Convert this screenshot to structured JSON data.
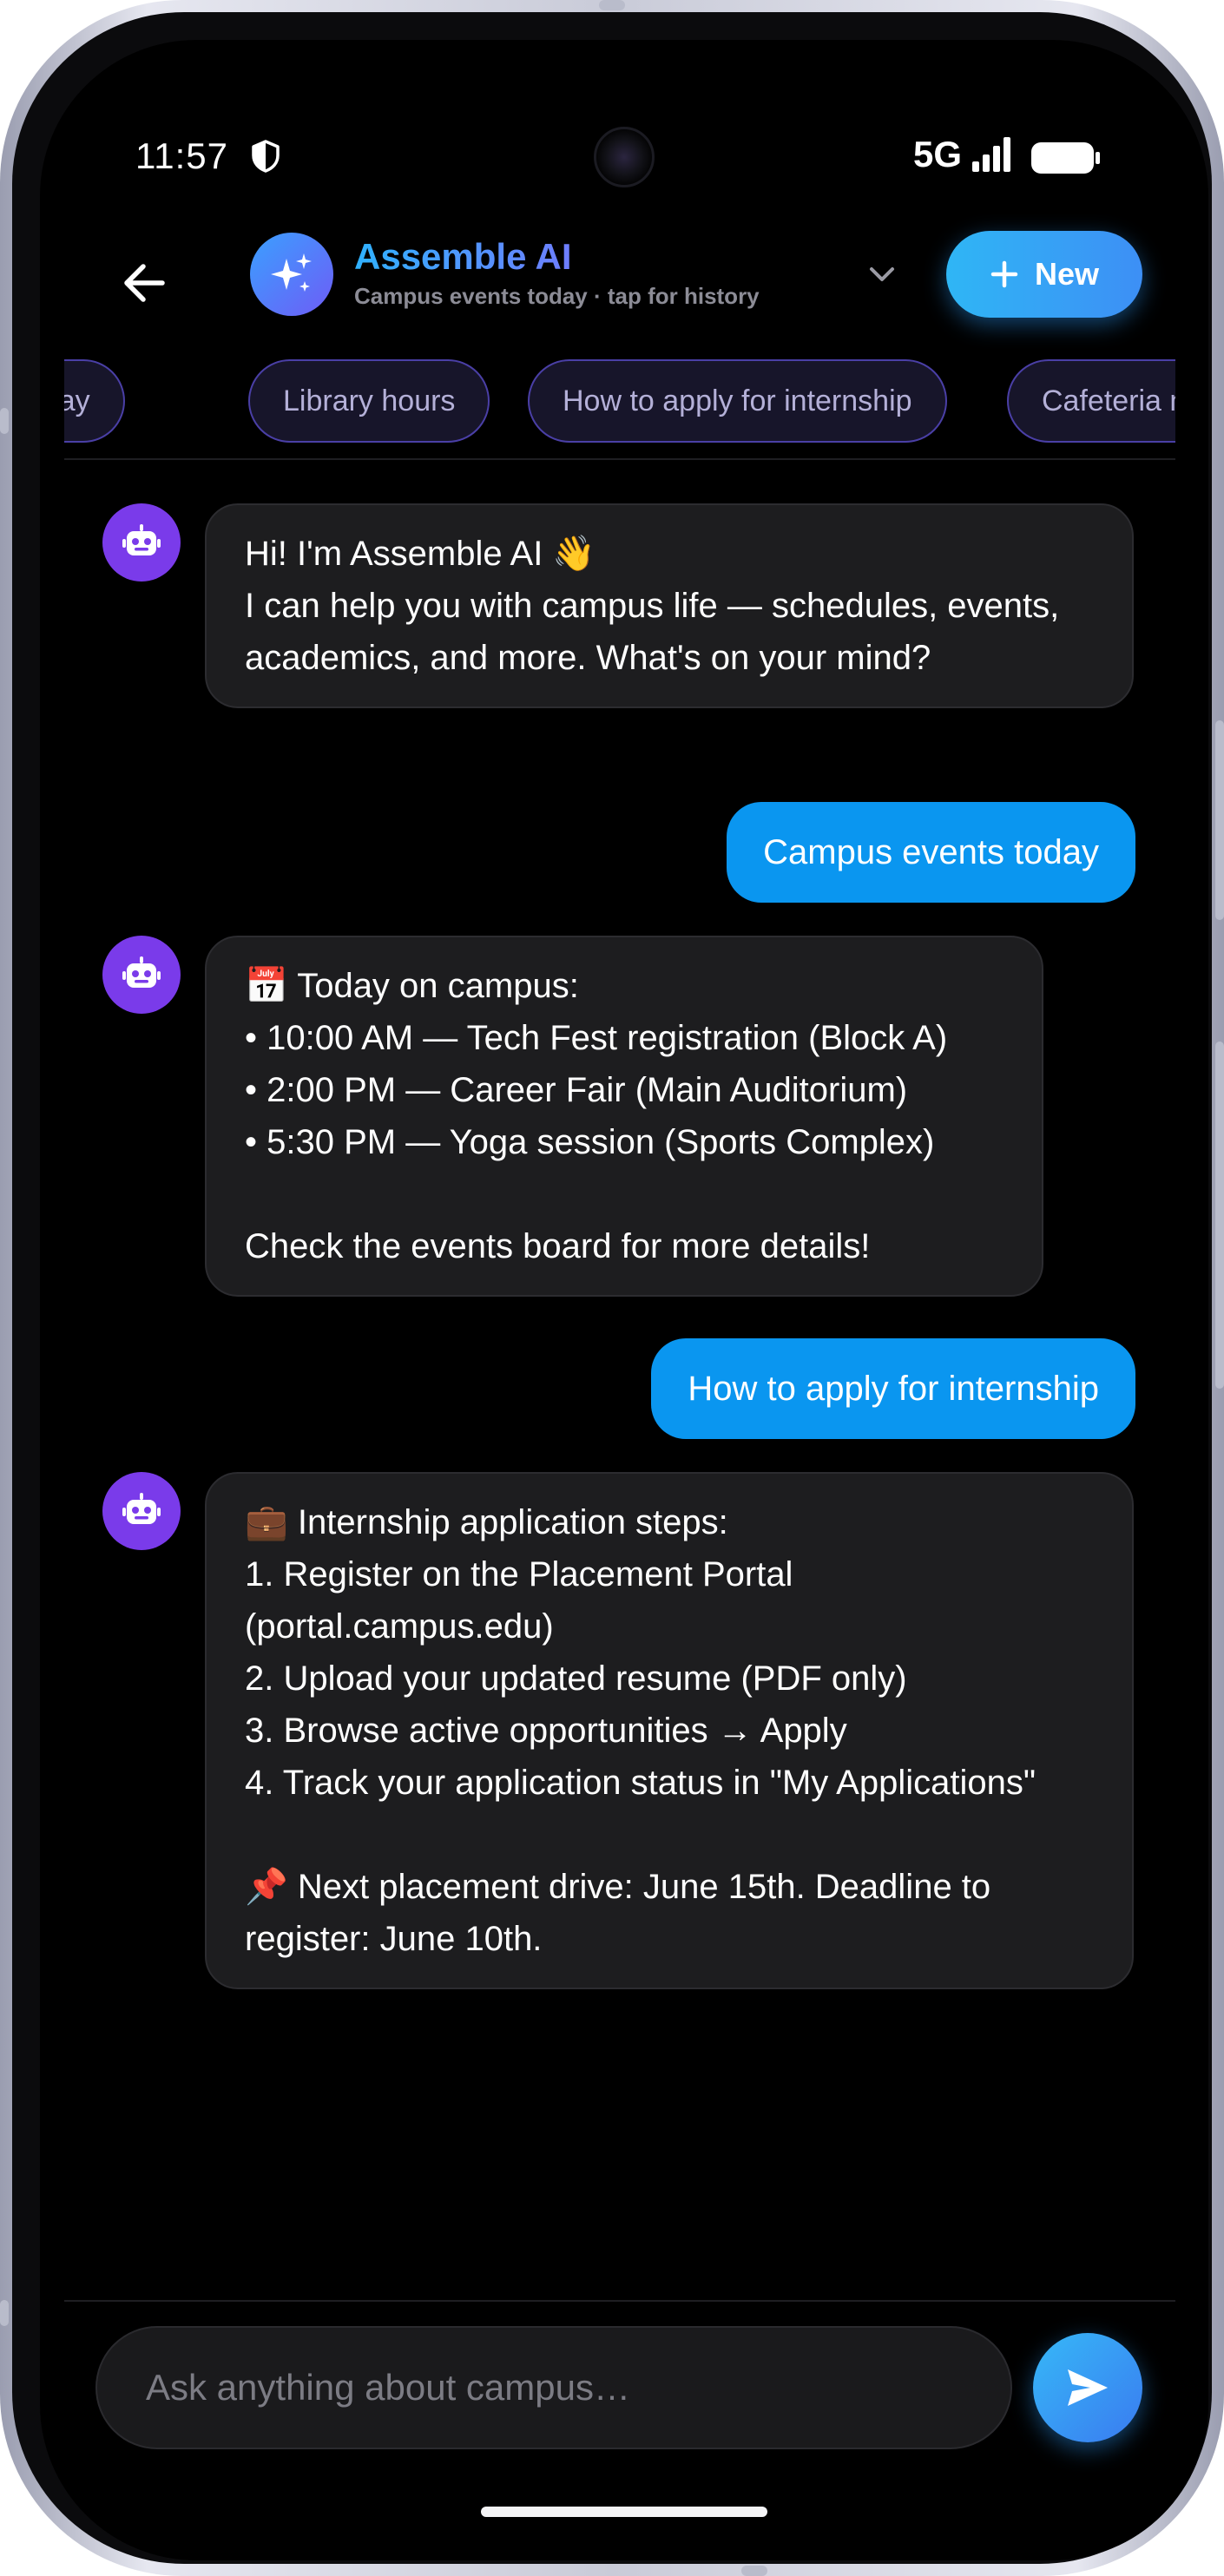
{
  "status_bar": {
    "time": "11:57",
    "network": "5G"
  },
  "header": {
    "title": "Assemble AI",
    "subtitle": "Campus events today · tap for history",
    "new_button_label": "New"
  },
  "suggestion_chips": [
    "s today",
    "Library hours",
    "How to apply for internship",
    "Cafeteria m"
  ],
  "messages": [
    {
      "role": "assistant",
      "text": "Hi! I'm Assemble AI 👋\nI can help you with campus life — schedules, events, academics, and more. What's on your mind?"
    },
    {
      "role": "user",
      "text": "Campus events today"
    },
    {
      "role": "assistant",
      "text": "📅 Today on campus:\n• 10:00 AM — Tech Fest registration (Block A)\n• 2:00 PM — Career Fair (Main Auditorium)\n• 5:30 PM — Yoga session (Sports Complex)\n\nCheck the events board for more details!"
    },
    {
      "role": "user",
      "text": "How to apply for internship"
    },
    {
      "role": "assistant",
      "text": "💼 Internship application steps:\n1. Register on the Placement Portal (portal.campus.edu)\n2. Upload your updated resume (PDF only)\n3. Browse active opportunities → Apply\n4. Track your application status in \"My Applications\"\n\n📌 Next placement drive: June 15th. Deadline to register: June 10th."
    }
  ],
  "composer": {
    "placeholder": "Ask anything about campus…"
  },
  "colors": {
    "background": "#000000",
    "bot_bubble": "#1d1d1f",
    "user_bubble": "#0a96f0",
    "accent": "#2fb2ff",
    "avatar": "#7a3bea",
    "chip_border": "#4a3fa6"
  },
  "icons": {
    "back": "arrow-left-icon",
    "logo": "sparkles-icon",
    "history": "chevron-down-icon",
    "new": "plus-icon",
    "avatar": "robot-icon",
    "send": "send-icon"
  }
}
